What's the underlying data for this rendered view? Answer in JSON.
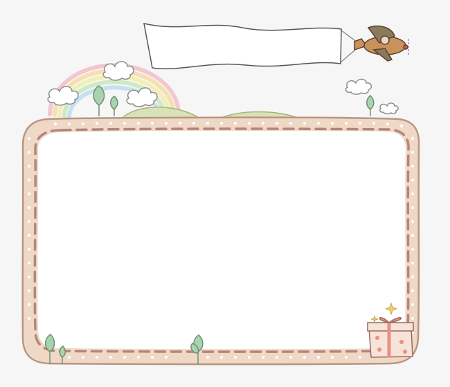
{
  "banner": {
    "text": ""
  },
  "frame": {
    "text": ""
  },
  "colors": {
    "background": "#f6f6f6",
    "frame_fill": "#efd9c6",
    "frame_outline": "#b99580",
    "dash": "#b38679",
    "inner": "#ffffff",
    "leaf": "#a9d3ae",
    "hill": "#d7e2b8",
    "plane": "#c9925a",
    "gift": "#f7e3d8",
    "ribbon": "#e88f86"
  },
  "icons": [
    "airplane-icon",
    "banner-flag",
    "rainbow-icon",
    "cloud-icon",
    "leaf-sprout-icon",
    "gift-box-icon",
    "sparkle-icon",
    "hill-icon"
  ]
}
